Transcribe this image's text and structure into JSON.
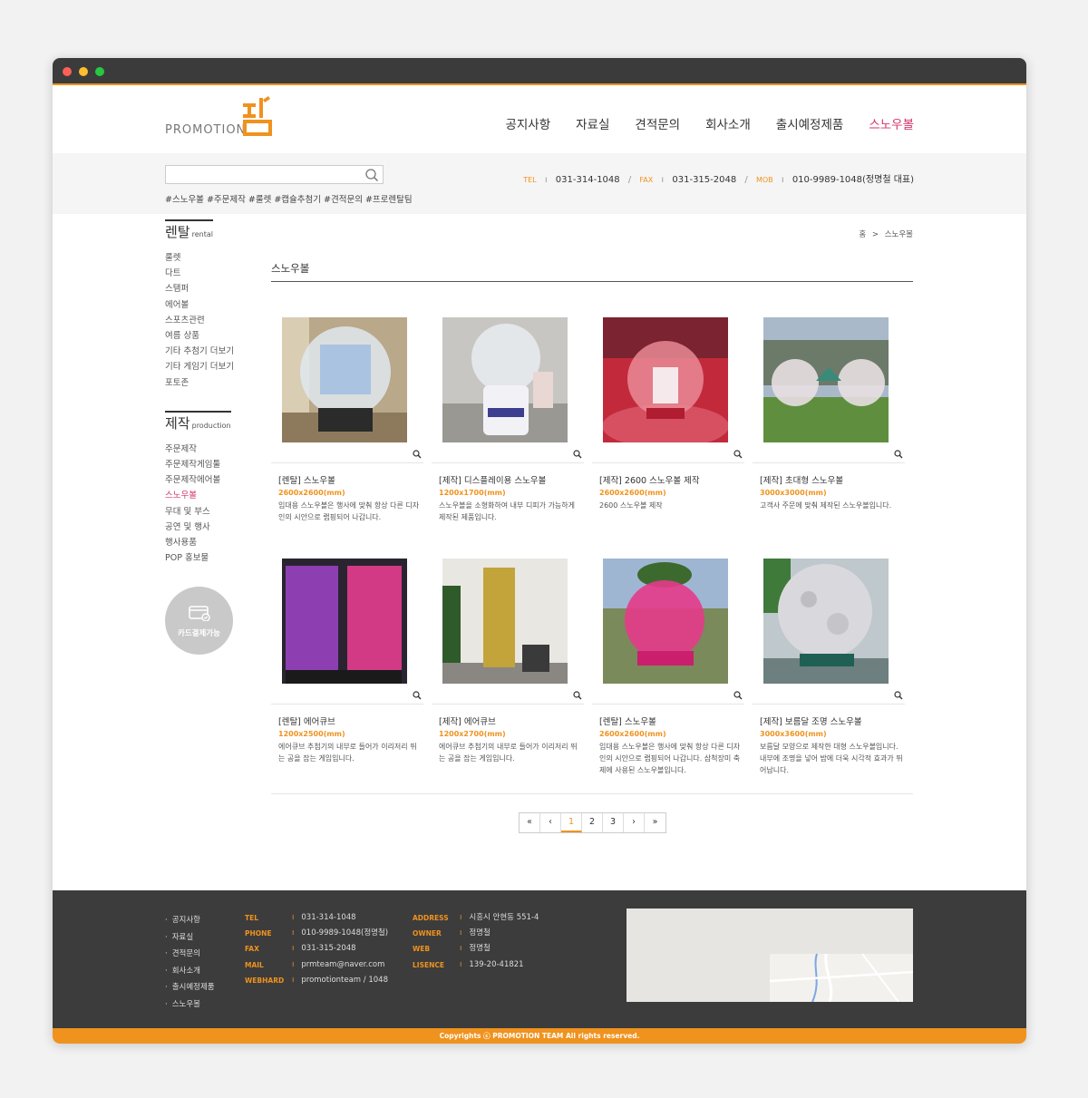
{
  "brand": {
    "logo_text": "PROMOTION",
    "accent": "#f0921e",
    "highlight": "#d6336c"
  },
  "nav": [
    "공지사항",
    "자료실",
    "견적문의",
    "회사소개",
    "출시예정제품",
    "스노우볼"
  ],
  "search": {
    "placeholder": "",
    "tags": "#스노우볼 #주문제작 #룰렛 #캡슐추첨기 #견적문의 #프로렌탈팀"
  },
  "contact": {
    "tel_label": "TEL",
    "tel": "031-314-1048",
    "fax_label": "FAX",
    "fax": "031-315-2048",
    "mob_label": "MOB",
    "mob": "010-9989-1048(정명철 대표)"
  },
  "sidebar": {
    "rental_title": "렌탈",
    "rental_sub": "rental",
    "rental_items": [
      "룰렛",
      "다트",
      "스탬퍼",
      "에어볼",
      "스포츠관련",
      "여름 상품",
      "기타 추첨기 더보기",
      "기타 게임기 더보기",
      "포토존"
    ],
    "production_title": "제작",
    "production_sub": "production",
    "production_items": [
      "주문제작",
      "주문제작게임툴",
      "주문제작에어볼",
      "스노우볼",
      "무대 및 부스",
      "공연 및 행사",
      "행사용품",
      "POP 홍보물"
    ],
    "card_pay": "카드결제가능"
  },
  "breadcrumb": {
    "home": "홈",
    "sep": ">",
    "current": "스노우볼"
  },
  "page_title": "스노우볼",
  "products": [
    {
      "title": "[렌탈] 스노우볼",
      "size": "2600x2600(mm)",
      "desc": "임대용 스노우볼은 행사에 맞춰 항상 다른 디자인의 시안으로 랩핑되어 나갑니다."
    },
    {
      "title": "[제작] 디스플레이용 스노우볼",
      "size": "1200x1700(mm)",
      "desc": "스노우볼을 소형화하여 내부 디피가 가능하게 제작된 제품입니다."
    },
    {
      "title": "[제작] 2600 스노우볼 제작",
      "size": "2600x2600(mm)",
      "desc": "2600 스노우볼 제작"
    },
    {
      "title": "[제작] 초대형 스노우볼",
      "size": "3000x3000(mm)",
      "desc": "고객사 주문에 맞춰 제작된 스노우볼입니다."
    },
    {
      "title": "[렌탈] 에어큐브",
      "size": "1200x2500(mm)",
      "desc": "에어큐브 추첨기의 내부로 들어가 이리저리 뛰는 공을 잡는 게임입니다."
    },
    {
      "title": "[제작] 에어큐브",
      "size": "1200x2700(mm)",
      "desc": "에어큐브 추첨기의 내부로 들어가 이리저리 뛰는 공을 잡는 게임입니다."
    },
    {
      "title": "[렌탈] 스노우볼",
      "size": "2600x2600(mm)",
      "desc": "임대용 스노우볼은 행사에 맞춰 항상 다른 디자인의 시안으로 랩핑되어 나갑니다. 삼척장미 축제에 사용된 스노우볼입니다."
    },
    {
      "title": "[제작] 보름달 조명 스노우볼",
      "size": "3000x3600(mm)",
      "desc": "보름달 모양으로 제작한 대형 스노우볼입니다. 내부에 조명을 넣어 밤에 더욱 시각적 효과가 뛰어납니다."
    }
  ],
  "pagination": {
    "first": "«",
    "prev": "‹",
    "pages": [
      "1",
      "2",
      "3"
    ],
    "current": "1",
    "next": "›",
    "last": "»"
  },
  "footer": {
    "nav": [
      "공지사항",
      "자료실",
      "견적문의",
      "회사소개",
      "출시예정제품",
      "스노우볼"
    ],
    "info1": [
      {
        "k": "TEL",
        "v": "031-314-1048"
      },
      {
        "k": "PHONE",
        "v": "010-9989-1048(정명철)"
      },
      {
        "k": "FAX",
        "v": "031-315-2048"
      },
      {
        "k": "MAIL",
        "v": "prmteam@naver.com"
      },
      {
        "k": "WEBHARD",
        "v": "promotionteam / 1048"
      }
    ],
    "info2": [
      {
        "k": "ADDRESS",
        "v": "시흥시 안현동 551-4"
      },
      {
        "k": "OWNER",
        "v": "정명철"
      },
      {
        "k": "WEB",
        "v": "정명철"
      },
      {
        "k": "LISENCE",
        "v": "139-20-41821"
      }
    ],
    "copyright": "Copyrights ⓒ PROMOTION TEAM All rights reserved."
  }
}
